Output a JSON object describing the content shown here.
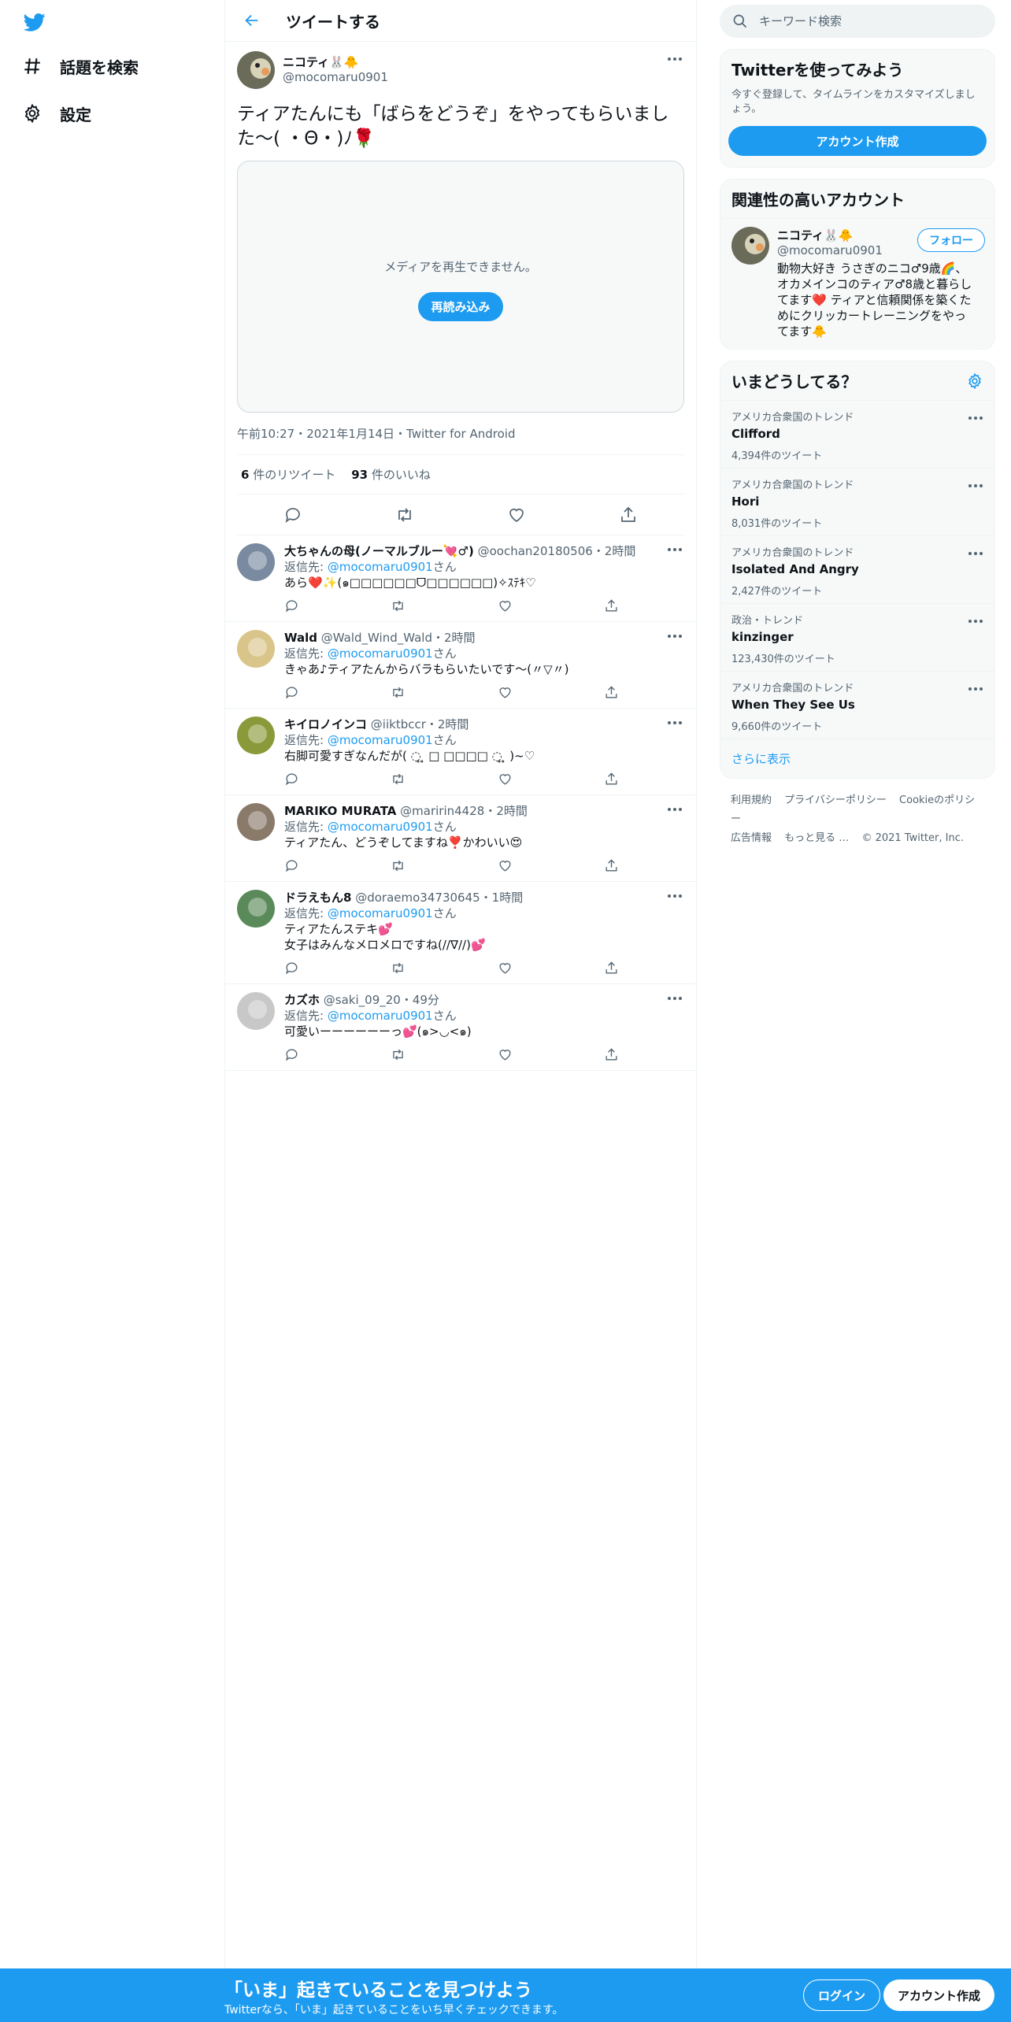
{
  "nav": {
    "logo_icon": "twitter-bird-icon",
    "items": [
      {
        "label": "話題を検索",
        "icon": "hashtag-icon"
      },
      {
        "label": "設定",
        "icon": "gear-icon"
      }
    ]
  },
  "header": {
    "title": "ツイートする"
  },
  "tweet": {
    "name": "ニコティ🐰🐥",
    "handle": "@mocomaru0901",
    "text": "ティアたんにも「ばらをどうぞ」をやってもらいました〜( ・Θ・)ﾉ🌹",
    "media_message": "メディアを再生できません。",
    "reload_label": "再読み込み",
    "timestamp": "午前10:27・2021年1月14日・Twitter for Android",
    "retweets_count": "6",
    "retweets_label": " 件のリツイート",
    "likes_count": "93",
    "likes_label": " 件のいいね"
  },
  "replies": [
    {
      "name": "大ちゃんの母(ノーマルブルー💘♂)",
      "handle": "@oochan20180506",
      "time": "・2時間",
      "reply_prefix": "返信先: ",
      "reply_to": "@mocomaru0901",
      "reply_suffix": "さん",
      "text": "あら❤️✨(๑□□□□□□ᗜ□□□□□□)✧ｽﾃｷ♡",
      "avatar_color": "#7a8aa0"
    },
    {
      "name": "Wald",
      "handle": "@Wald_Wind_Wald",
      "time": "・2時間",
      "reply_prefix": "返信先: ",
      "reply_to": "@mocomaru0901",
      "reply_suffix": "さん",
      "text": "きゃあ♪ティアたんからバラもらいたいです〜(〃▽〃)",
      "avatar_color": "#d9c58a"
    },
    {
      "name": "キイロノインコ",
      "handle": "@iiktbccr",
      "time": "・2時間",
      "reply_prefix": "返信先: ",
      "reply_to": "@mocomaru0901",
      "reply_suffix": "さん",
      "text": "右脚可愛すぎなんだが( ◌̥ ̥ □ □□□□ ◌̥ ̥ )~♡",
      "avatar_color": "#8a9a3a"
    },
    {
      "name": "MARIKO MURATA",
      "handle": "@maririn4428",
      "time": "・2時間",
      "reply_prefix": "返信先: ",
      "reply_to": "@mocomaru0901",
      "reply_suffix": "さん",
      "text": "ティアたん、どうぞしてますね❣️かわいい😍",
      "avatar_color": "#8a7a6a"
    },
    {
      "name": "ドラえもん8",
      "handle": "@doraemo34730645",
      "time": "・1時間",
      "reply_prefix": "返信先: ",
      "reply_to": "@mocomaru0901",
      "reply_suffix": "さん",
      "text": "ティアたんステキ💕",
      "text2": "女子はみんなメロメロですね(//∇//)💕",
      "avatar_color": "#5a8a5a"
    },
    {
      "name": "カズホ",
      "handle": "@saki_09_20",
      "time": "・49分",
      "reply_prefix": "返信先: ",
      "reply_to": "@mocomaru0901",
      "reply_suffix": "さん",
      "text": "可愛いーーーーーーっ💕(๑>◡<๑)",
      "avatar_color": "#c8c8c8"
    }
  ],
  "search": {
    "placeholder": "キーワード検索"
  },
  "signup_panel": {
    "title": "Twitterを使ってみよう",
    "desc": "今すぐ登録して、タイムラインをカスタマイズしましょう。",
    "button": "アカウント作成"
  },
  "related": {
    "title": "関連性の高いアカウント",
    "name": "ニコティ🐰🐥",
    "handle": "@mocomaru0901",
    "follow_label": "フォロー",
    "bio": "動物大好き うさぎのニコ♂9歳🌈、オカメインコのティア♂8歳と暮らしてます❤️ ティアと信頼関係を築くためにクリッカートレーニングをやってます🐥"
  },
  "trends": {
    "title": "いまどうしてる？",
    "items": [
      {
        "context": "アメリカ合衆国のトレンド",
        "name": "Clifford",
        "count": "4,394件のツイート"
      },
      {
        "context": "アメリカ合衆国のトレンド",
        "name": "Hori",
        "count": "8,031件のツイート"
      },
      {
        "context": "アメリカ合衆国のトレンド",
        "name": "Isolated And Angry",
        "count": "2,427件のツイート"
      },
      {
        "context": "政治・トレンド",
        "name": "kinzinger",
        "count": "123,430件のツイート"
      },
      {
        "context": "アメリカ合衆国のトレンド",
        "name": "When They See Us",
        "count": "9,660件のツイート"
      }
    ],
    "show_more": "さらに表示"
  },
  "footer": {
    "links": [
      "利用規約",
      "プライバシーポリシー",
      "Cookieのポリシー",
      "広告情報",
      "もっと見る …"
    ],
    "copyright": "© 2021 Twitter, Inc."
  },
  "bottom_bar": {
    "title": "「いま」起きていることを見つけよう",
    "subtitle": "Twitterなら、「いま」起きていることをいち早くチェックできます。",
    "login": "ログイン",
    "signup": "アカウント作成"
  },
  "colors": {
    "accent": "#1d9bf0",
    "text": "#0f1419",
    "muted": "#536471",
    "border": "#eff3f4"
  }
}
